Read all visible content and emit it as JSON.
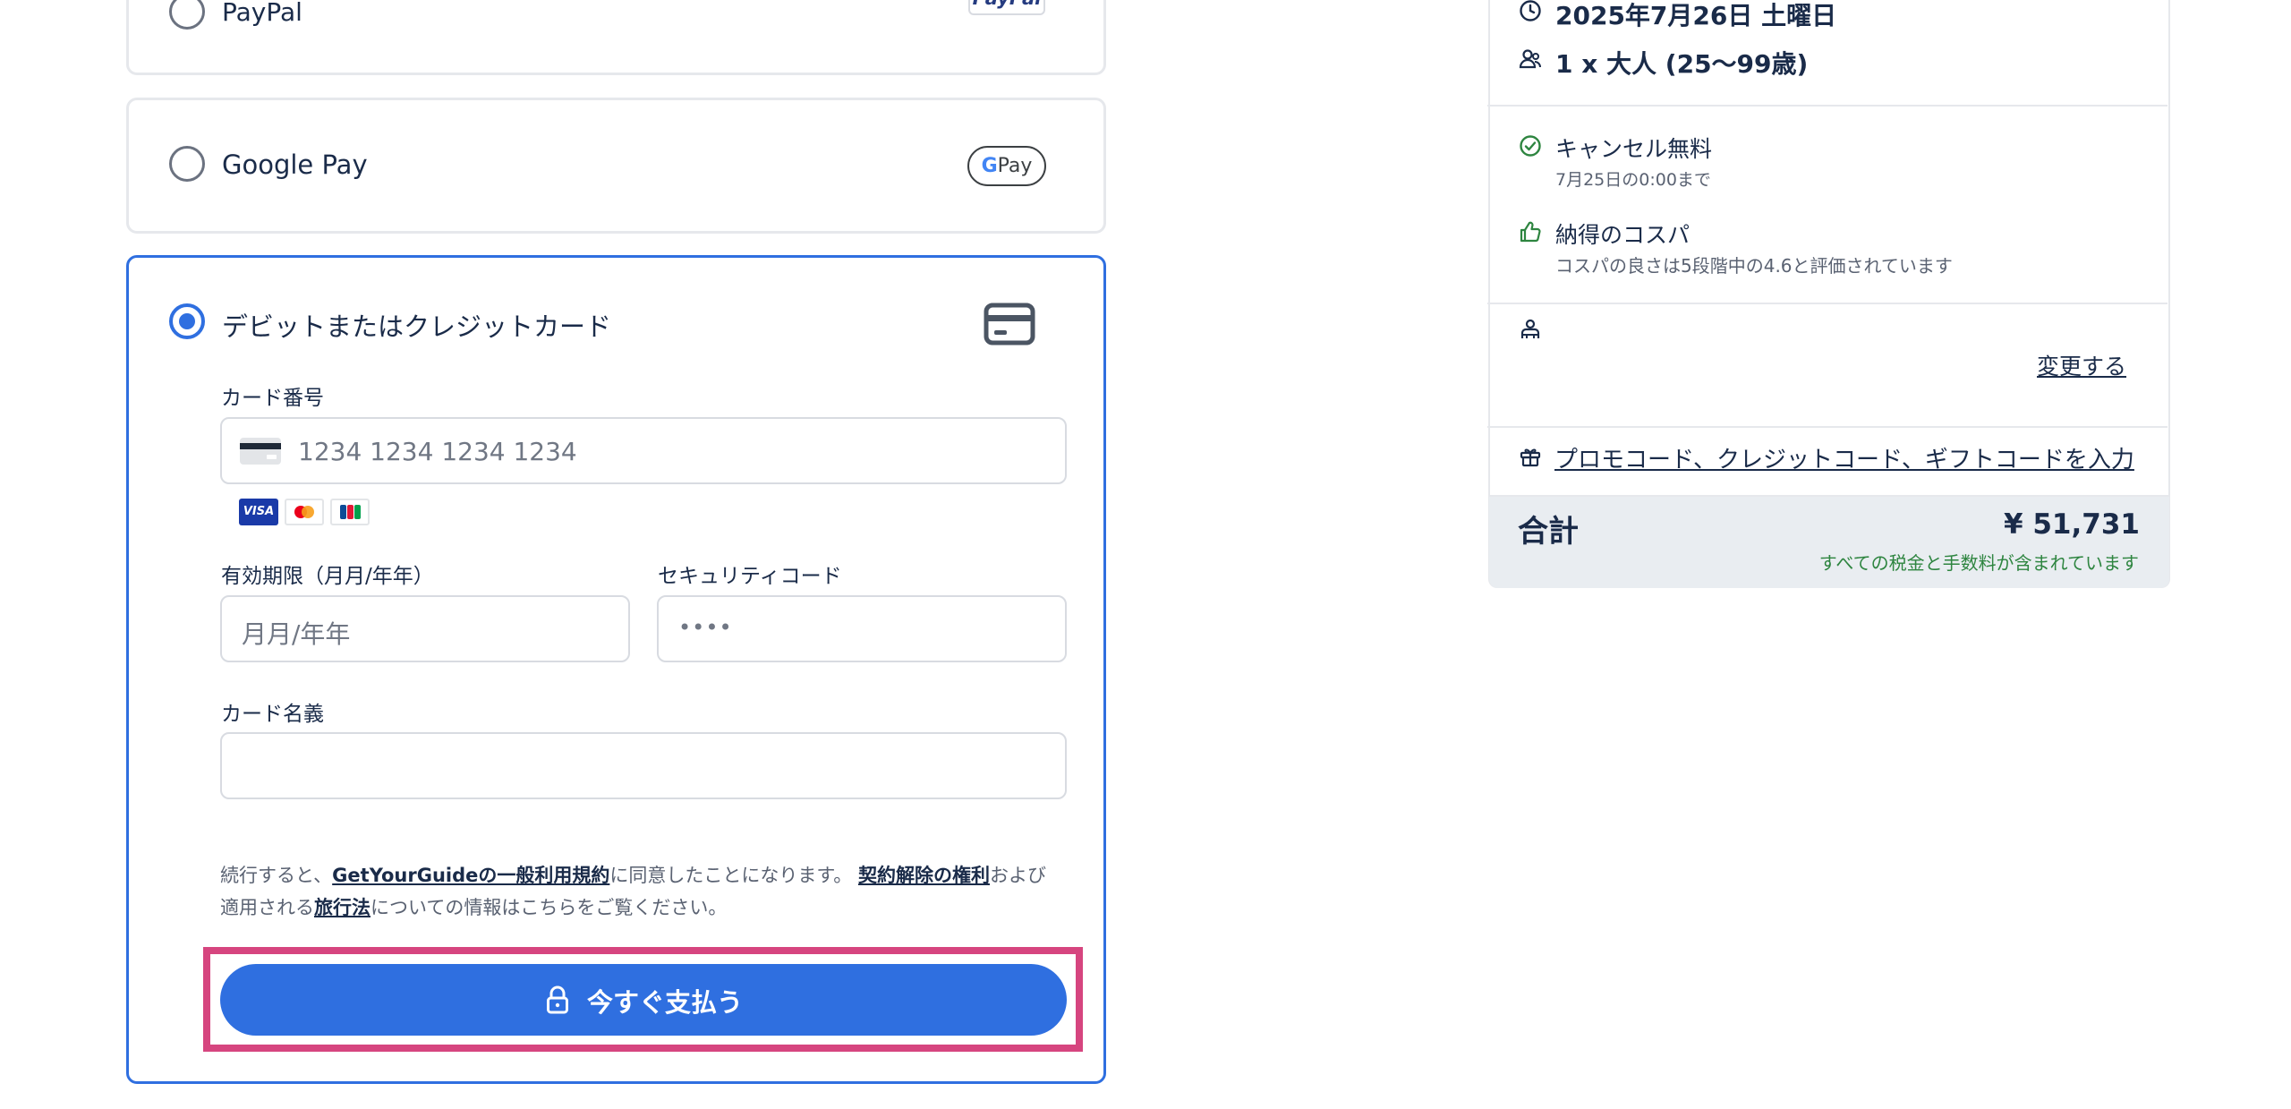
{
  "payment": {
    "paypal": {
      "label": "PayPal",
      "badge": "PayPal"
    },
    "google_pay": {
      "label": "Google Pay",
      "badge_g": "G",
      "badge_pay": "Pay"
    },
    "card": {
      "label": "デビットまたはクレジットカード",
      "number_label": "カード番号",
      "number_placeholder": "1234 1234 1234 1234",
      "brands": [
        "VISA",
        "mastercard",
        "JCB"
      ],
      "expiry_label": "有効期限（月月/年年）",
      "expiry_placeholder": "月月/年年",
      "cvc_label": "セキュリティコード",
      "cvc_placeholder": "••••",
      "name_label": "カード名義",
      "name_value": ""
    },
    "legal": {
      "part1": "続行すると、",
      "terms_link": "GetYourGuideの一般利用規約",
      "part2": "に同意したことになります。",
      "withdrawal_link": "契約解除の権利",
      "part3": "および",
      "part4": "適用される",
      "travel_law_link": "旅行法",
      "part5": "についての情報はこちらをご覧ください。"
    },
    "pay_button": "今すぐ支払う"
  },
  "summary": {
    "date": "2025年7月26日 土曜日",
    "participants": "1 x 大人 (25〜99歳)",
    "cancel_title": "キャンセル無料",
    "cancel_sub": "7月25日の0:00まで",
    "value_title": "納得のコスパ",
    "value_sub": "コスパの良さは5段階中の4.6と評価されています",
    "change_link": "変更する",
    "promo_link": "プロモコード、クレジットコード、ギフトコードを入力",
    "total_label": "合計",
    "total_value": "¥ 51,731",
    "total_note": "すべての税金と手数料が含まれています"
  },
  "colors": {
    "accent": "#2f6fe0",
    "highlight": "#d6457f",
    "text_dark": "#1a2b49",
    "green": "#2e8540",
    "total_bg": "#e9edf1"
  }
}
